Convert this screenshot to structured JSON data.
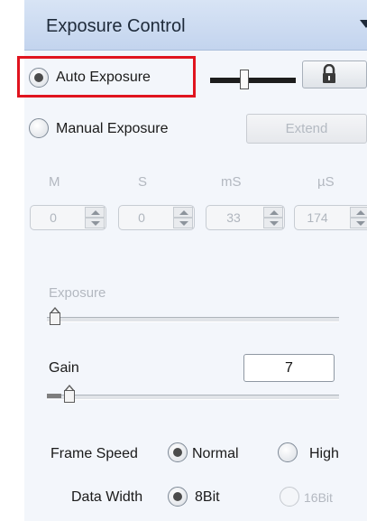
{
  "panel": {
    "title": "Exposure Control"
  },
  "auto_exposure": {
    "label": "Auto Exposure",
    "selected": true
  },
  "manual_exposure": {
    "label": "Manual Exposure",
    "selected": false
  },
  "extend_button": {
    "label": "Extend"
  },
  "time_units": {
    "minutes": "M",
    "seconds": "S",
    "milliseconds": "mS",
    "microseconds": "µS"
  },
  "time_values": {
    "minutes": "0",
    "seconds": "0",
    "milliseconds": "33",
    "microseconds": "174"
  },
  "exposure": {
    "label": "Exposure",
    "slider_fraction": 0.0
  },
  "gain": {
    "label": "Gain",
    "value": "7",
    "slider_fraction": 0.05
  },
  "frame_speed": {
    "label": "Frame Speed",
    "options": [
      "Normal",
      "High"
    ],
    "selected": "Normal"
  },
  "data_width": {
    "label": "Data Width",
    "options": [
      "8Bit",
      "16Bit"
    ],
    "selected": "8Bit"
  },
  "icons": {
    "lock": "lock-icon",
    "collapse": "chevron-down-icon"
  },
  "colors": {
    "highlight": "#e0141e",
    "header": "#c3d4ee"
  }
}
